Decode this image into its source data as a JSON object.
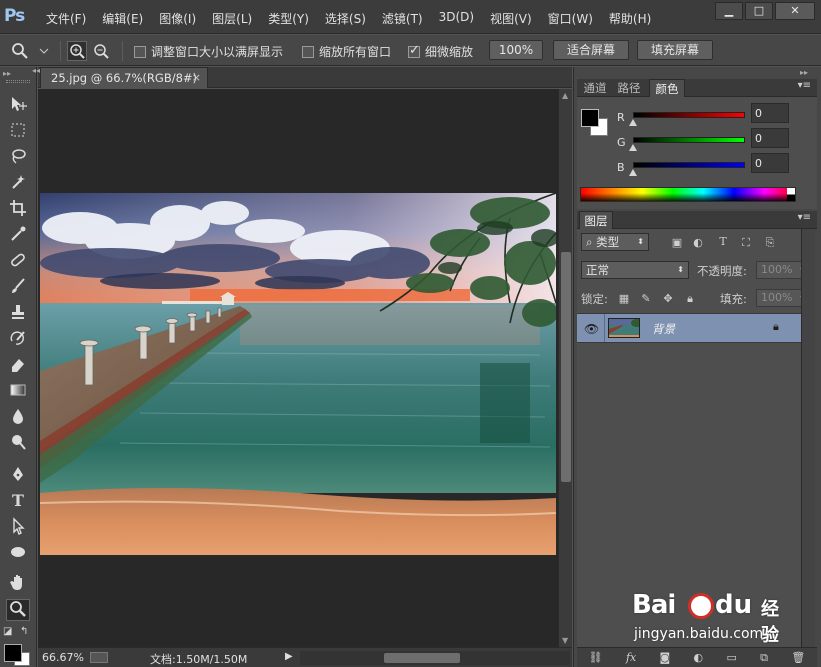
{
  "app": {
    "logo": "Ps"
  },
  "menu": [
    "文件(F)",
    "编辑(E)",
    "图像(I)",
    "图层(L)",
    "类型(Y)",
    "选择(S)",
    "滤镜(T)",
    "3D(D)",
    "视图(V)",
    "窗口(W)",
    "帮助(H)"
  ],
  "window_controls": {
    "minimize": "▁",
    "maximize": "□",
    "close": "✕"
  },
  "options": {
    "tool_icon": "magnifier-icon",
    "resize_windows_label": "调整窗口大小以满屏显示",
    "resize_windows_checked": false,
    "zoom_all_label": "缩放所有窗口",
    "zoom_all_checked": false,
    "scrubby_zoom_label": "细微缩放",
    "scrubby_zoom_checked": true,
    "btn_100": "100%",
    "btn_fit": "适合屏幕",
    "btn_fill": "填充屏幕"
  },
  "document": {
    "tab_title": "25.jpg @ 66.7%(RGB/8#)",
    "tab_close": "×"
  },
  "status": {
    "zoom": "66.67%",
    "doc_info": "文档:1.50M/1.50M",
    "arrow": "▶"
  },
  "color_panel": {
    "tabs": [
      "通道",
      "路径",
      "颜色"
    ],
    "active_tab": "颜色",
    "sliders": [
      {
        "label": "R",
        "value": "0",
        "color": "#ff0000"
      },
      {
        "label": "G",
        "value": "0",
        "color": "#00ff00"
      },
      {
        "label": "B",
        "value": "0",
        "color": "#0000ff"
      }
    ],
    "foreground": "#000000",
    "background": "#ffffff"
  },
  "layers_panel": {
    "tab": "图层",
    "filter_type": "类型",
    "blend_mode": "正常",
    "opacity_label": "不透明度:",
    "opacity_value": "100%",
    "lock_label": "锁定:",
    "fill_label": "填充:",
    "fill_value": "100%",
    "layers": [
      {
        "name": "背景",
        "visible": true,
        "locked": true
      }
    ],
    "footer_icons": [
      "link-icon",
      "fx-icon",
      "mask-icon",
      "adjustment-icon",
      "folder-icon",
      "new-layer-icon",
      "trash-icon"
    ]
  },
  "watermark": {
    "brand_a": "Bai",
    "brand_b": "du",
    "product": "经验",
    "url": "jingyan.baidu.com"
  }
}
